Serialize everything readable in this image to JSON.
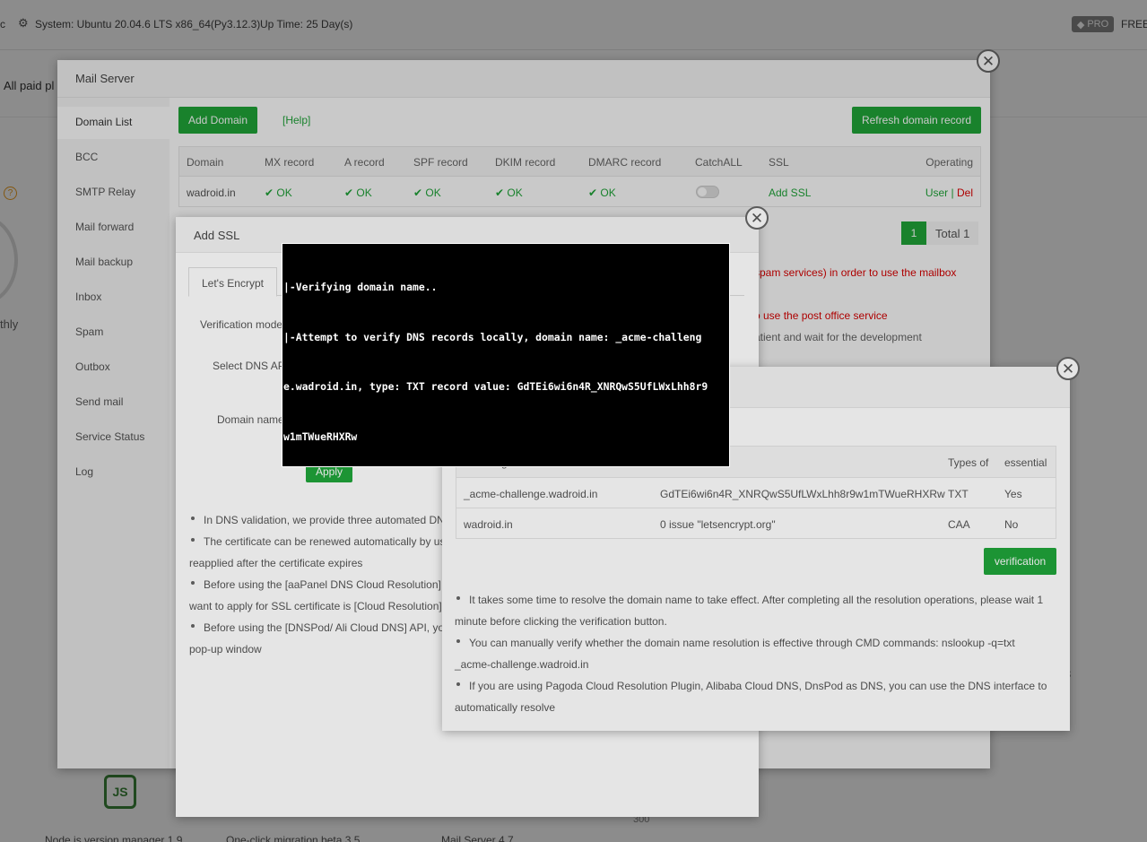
{
  "topbar": {
    "system": "System: Ubuntu 20.04.6 LTS x86_64(Py3.12.3)",
    "uptime": "Up Time: 25 Day(s)",
    "left_fragment": "c",
    "pro_label": "PRO",
    "free_label": "FREE"
  },
  "background": {
    "banner": "All paid pl",
    "monthly": "thly",
    "node_label": "Node.js version manager 1.9",
    "migration_label": "One-click migration beta 3.5",
    "mailserver_label": "Mail Server 4.7",
    "chart_tick": "300",
    "side_digit": "3"
  },
  "mail_server": {
    "title": "Mail Server",
    "sidebar": [
      "Domain List",
      "BCC",
      "SMTP Relay",
      "Mail forward",
      "Mail backup",
      "Inbox",
      "Spam",
      "Outbox",
      "Send mail",
      "Service Status",
      "Log"
    ],
    "add_domain": "Add Domain",
    "help": "[Help]",
    "refresh": "Refresh domain record",
    "columns": [
      "Domain",
      "MX record",
      "A record",
      "SPF record",
      "DKIM record",
      "DMARC record",
      "CatchALL",
      "SSL",
      "Operating"
    ],
    "row": {
      "domain": "wadroid.in",
      "mx": "OK",
      "a": "OK",
      "spf": "OK",
      "dkim": "OK",
      "dmarc": "OK",
      "ssl": "Add SSL",
      "user": "User",
      "sep": "|",
      "del": "Del"
    },
    "page_current": "1",
    "page_total": "Total 1",
    "warn_spam": "spam services) in order to use the mailbox",
    "warn_post": "o use the post office service",
    "note_patient": "atient and wait for the development"
  },
  "add_ssl": {
    "title": "Add SSL",
    "tab": "Let's Encrypt",
    "verification_mode": "Verification mode",
    "select_dns": "Select DNS AP",
    "domain_name": "Domain name",
    "apply": "Apply",
    "notes": [
      "In DNS validation, we provide three automated DN",
      "The certificate can be renewed automatically by us",
      "reapplied after the certificate expires",
      "Before using the [aaPanel DNS Cloud Resolution] A",
      "want to apply for SSL certificate is [Cloud Resolution]",
      "Before using the [DNSPod/ Ali Cloud DNS] API, yo",
      "pop-up window"
    ]
  },
  "dns_dialog": {
    "header_record": "g",
    "header_type": "Types of",
    "header_essential": "essential",
    "rows": [
      {
        "host": "_acme-challenge.wadroid.in",
        "value": "GdTEi6wi6n4R_XNRQwS5UfLWxLhh8r9w1mTWueRHXRw",
        "type": "TXT",
        "essential": "Yes"
      },
      {
        "host": "wadroid.in",
        "value": "0 issue \"letsencrypt.org\"",
        "type": "CAA",
        "essential": "No"
      }
    ],
    "verify": "verification",
    "notes": [
      "It takes some time to resolve the domain name to take effect. After completing all the resolution operations, please wait 1",
      "minute before clicking the verification button.",
      "You can manually verify whether the domain name resolution is effective through CMD commands: nslookup -q=txt",
      "_acme-challenge.wadroid.in",
      "If you are using Pagoda Cloud Resolution Plugin, Alibaba Cloud DNS, DnsPod as DNS, you can use the DNS interface to",
      "automatically resolve"
    ]
  },
  "console": {
    "lines": [
      "|-Verifying domain name..",
      "|-Attempt to verify DNS records locally, domain name: _acme-challeng",
      "e.wadroid.in, type: TXT record value: GdTEi6wi6n4R_XNRQwS5UfLWxLhh8r9",
      "w1mTWueRHXRw"
    ]
  },
  "icons": {
    "close": "close-icon",
    "check": "check-icon",
    "toggle": "toggle-icon",
    "gear": "gear-icon",
    "nodejs": "nodejs-icon"
  }
}
